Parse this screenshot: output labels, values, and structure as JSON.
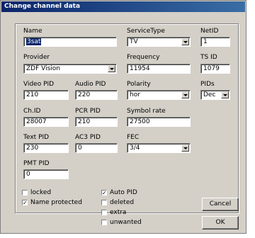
{
  "window": {
    "title": "Change channel data"
  },
  "fields": {
    "name": {
      "label": "Name",
      "value": "3sat"
    },
    "service_type": {
      "label": "ServiceType",
      "value": "TV"
    },
    "net_id": {
      "label": "NetID",
      "value": "1"
    },
    "provider": {
      "label": "Provider",
      "value": "ZDF Vision"
    },
    "frequency": {
      "label": "Frequency",
      "value": "11954"
    },
    "ts_id": {
      "label": "TS ID",
      "value": "1079"
    },
    "video_pid": {
      "label": "Video PID",
      "value": "210"
    },
    "audio_pid": {
      "label": "Audio PID",
      "value": "220"
    },
    "polarity": {
      "label": "Polarity",
      "value": "hor"
    },
    "pids": {
      "label": "PIDs",
      "value": "Dec"
    },
    "ch_id": {
      "label": "Ch.ID",
      "value": "28007"
    },
    "pcr_pid": {
      "label": "PCR PID",
      "value": "210"
    },
    "symbol_rate": {
      "label": "Symbol rate",
      "value": "27500"
    },
    "text_pid": {
      "label": "Text PID",
      "value": "230"
    },
    "ac3_pid": {
      "label": "AC3 PID",
      "value": "0"
    },
    "fec": {
      "label": "FEC",
      "value": "3/4"
    },
    "pmt_pid": {
      "label": "PMT PID",
      "value": "0"
    }
  },
  "checkboxes": {
    "locked": {
      "label": "locked",
      "checked": ""
    },
    "name_protected": {
      "label": "Name protected",
      "checked": "✓"
    },
    "auto_pid": {
      "label": "Auto PID",
      "checked": "✓"
    },
    "deleted": {
      "label": "deleted",
      "checked": ""
    },
    "extra": {
      "label": "extra",
      "checked": ""
    },
    "unwanted": {
      "label": "unwanted",
      "checked": ""
    }
  },
  "buttons": {
    "cancel": "Cancel",
    "ok": "OK"
  }
}
